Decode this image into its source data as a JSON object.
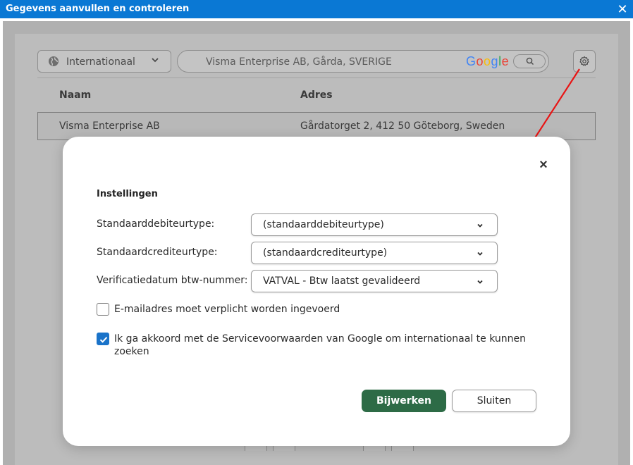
{
  "window": {
    "title": "Gegevens aanvullen en controleren",
    "close_glyph": "✕",
    "titlebar_color": "#0a78d4"
  },
  "background": {
    "region_select": {
      "value": "Internationaal",
      "icon": "globe-icon"
    },
    "search": {
      "value": "Visma Enterprise AB, Gårda, SVERIGE",
      "brand": [
        {
          "char": "G",
          "color": "#4285F4"
        },
        {
          "char": "o",
          "color": "#EA4335"
        },
        {
          "char": "o",
          "color": "#FBBC05"
        },
        {
          "char": "g",
          "color": "#4285F4"
        },
        {
          "char": "l",
          "color": "#34A853"
        },
        {
          "char": "e",
          "color": "#EA4335"
        }
      ]
    },
    "table": {
      "columns": [
        "Naam",
        "Adres"
      ],
      "rows": [
        {
          "name": "Visma Enterprise AB",
          "address": "Gårdatorget 2, 412 50 Göteborg, Sweden"
        }
      ]
    }
  },
  "annotation": {
    "arrow_color": "#e81414"
  },
  "modal": {
    "close_glyph": "×",
    "heading": "Instellingen",
    "fields": [
      {
        "label": "Standaarddebiteurtype:",
        "value": "(standaarddebiteurtype)"
      },
      {
        "label": "Standaardcrediteurtype:",
        "value": "(standaardcrediteurtype)"
      },
      {
        "label": "Verificatiedatum btw-nummer:",
        "value": "VATVAL - Btw laatst gevalideerd"
      }
    ],
    "checkboxes": [
      {
        "label": "E-mailadres moet verplicht worden ingevoerd",
        "checked": false
      },
      {
        "label_line1": "Ik ga akkoord met de Servicevoorwaarden van Google om internationaal te kunnen",
        "label_line2": "zoeken",
        "checked": true
      }
    ],
    "buttons": {
      "update": "Bijwerken",
      "close": "Sluiten"
    },
    "accent_color": "#2d6b46",
    "checkbox_color": "#1a73c9"
  }
}
